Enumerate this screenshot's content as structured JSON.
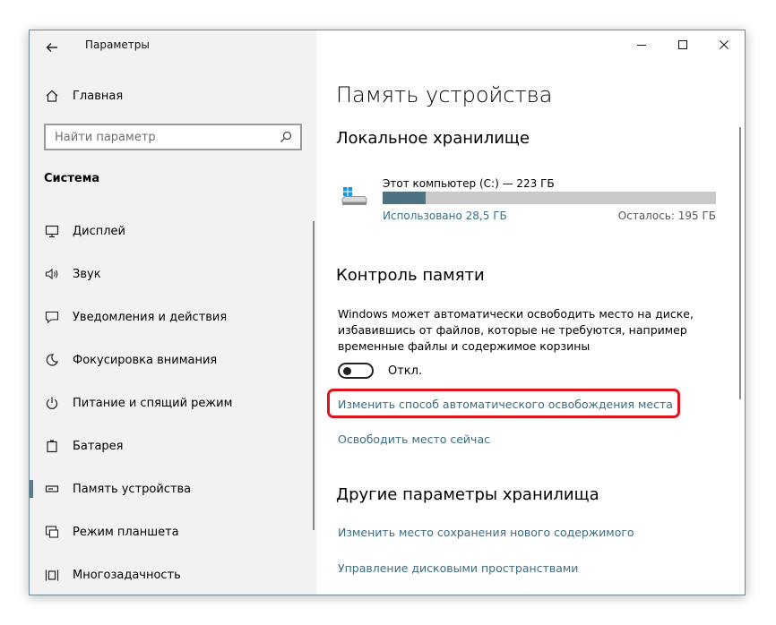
{
  "app": {
    "title": "Параметры"
  },
  "sidebar": {
    "home": {
      "label": "Главная",
      "icon": "home-icon"
    },
    "search": {
      "placeholder": "Найти параметр",
      "icon": "search-icon"
    },
    "section": "Система",
    "items": [
      {
        "label": "Дисплей",
        "icon": "monitor-icon"
      },
      {
        "label": "Звук",
        "icon": "speaker-icon"
      },
      {
        "label": "Уведомления и действия",
        "icon": "message-icon"
      },
      {
        "label": "Фокусировка внимания",
        "icon": "moon-icon"
      },
      {
        "label": "Питание и спящий режим",
        "icon": "power-icon"
      },
      {
        "label": "Батарея",
        "icon": "battery-icon"
      },
      {
        "label": "Память устройства",
        "icon": "storage-icon",
        "active": true
      },
      {
        "label": "Режим планшета",
        "icon": "tablet-mode-icon"
      },
      {
        "label": "Многозадачность",
        "icon": "multitasking-icon"
      }
    ]
  },
  "titlebar": {
    "buttons": [
      "minimize",
      "maximize",
      "close"
    ]
  },
  "main": {
    "title": "Память устройства",
    "local_storage": {
      "heading": "Локальное хранилище",
      "drive_name": "Этот компьютер (C:) — 223 ГБ",
      "used": "Использовано 28,5 ГБ",
      "free": "Осталось: 195 ГБ",
      "used_fraction": 0.128,
      "bar_color": "#4d7284"
    },
    "storage_sense": {
      "heading": "Контроль памяти",
      "description": "Windows может автоматически освободить место на диске, избавившись от файлов, которые не требуются, например временные файлы и содержимое корзины",
      "toggle_label": "Откл.",
      "toggle_on": false,
      "link_change": "Изменить способ автоматического освобождения места",
      "link_free_now": "Освободить место сейчас",
      "highlight_color": "#e0121b"
    },
    "other": {
      "heading": "Другие параметры хранилища",
      "link_save_location": "Изменить место сохранения нового содержимого",
      "link_spaces": "Управление дисковыми пространствами"
    }
  }
}
